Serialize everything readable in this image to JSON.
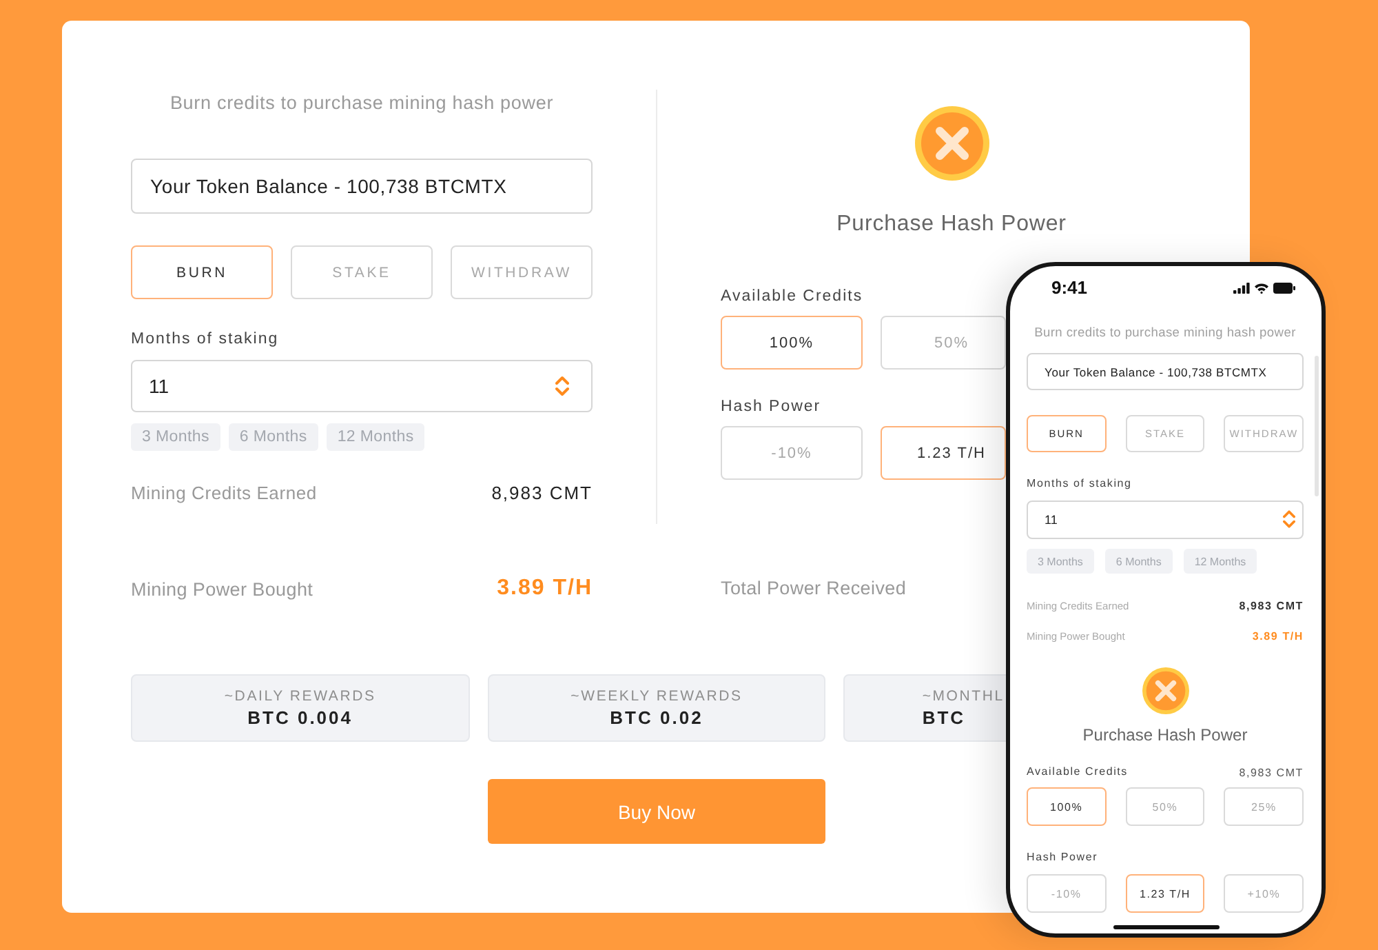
{
  "desktop": {
    "burn_panel": {
      "subtitle": "Burn credits to purchase mining hash power",
      "token_balance": {
        "value": "Your Token Balance - 100,738 BTCMTX"
      },
      "actions": [
        {
          "label": "BURN",
          "selected": true
        },
        {
          "label": "STAKE",
          "selected": false
        },
        {
          "label": "WITHDRAW",
          "selected": false
        }
      ],
      "months_label": "Months of staking",
      "months_input": {
        "value": "11"
      },
      "month_presets": [
        "3 Months",
        "6 Months",
        "12 Months"
      ],
      "credits_earned": {
        "label": "Mining Credits Earned",
        "value": "8,983 CMT"
      }
    },
    "purchase_panel": {
      "title": "Purchase Hash Power",
      "available_credits": {
        "label": "Available Credits",
        "options": [
          {
            "label": "100%",
            "selected": true
          },
          {
            "label": "50%",
            "selected": false
          }
        ]
      },
      "hash_power": {
        "label": "Hash Power",
        "options": [
          {
            "label": "-10%",
            "selected": false
          },
          {
            "label": "1.23 T/H",
            "selected": true
          }
        ]
      }
    },
    "power_bought": {
      "label": "Mining Power Bought",
      "value": "3.89 T/H"
    },
    "total_power": {
      "label": "Total Power Received"
    },
    "rewards": [
      {
        "label": "~DAILY REWARDS",
        "value": "BTC 0.004"
      },
      {
        "label": "~WEEKLY REWARDS",
        "value": "BTC 0.02"
      },
      {
        "label": "~MONTHL",
        "value": "BTC"
      }
    ],
    "buy_button": "Buy Now"
  },
  "phone": {
    "status_time": "9:41",
    "subtitle": "Burn credits to purchase mining hash power",
    "token_balance": {
      "value": "Your Token Balance - 100,738 BTCMTX"
    },
    "actions": [
      {
        "label": "BURN",
        "selected": true
      },
      {
        "label": "STAKE",
        "selected": false
      },
      {
        "label": "WITHDRAW",
        "selected": false
      }
    ],
    "months_label": "Months of staking",
    "months_input": {
      "value": "11"
    },
    "month_presets": [
      "3 Months",
      "6 Months",
      "12 Months"
    ],
    "stats": [
      {
        "label": "Mining Credits Earned",
        "value": "8,983 CMT",
        "highlighted": false
      },
      {
        "label": "Mining Power Bought",
        "value": "3.89 T/H",
        "highlighted": true
      }
    ],
    "title": "Purchase Hash Power",
    "available_credits": {
      "label": "Available Credits",
      "balance": "8,983 CMT",
      "options": [
        {
          "label": "100%",
          "selected": true
        },
        {
          "label": "50%",
          "selected": false
        },
        {
          "label": "25%",
          "selected": false
        }
      ]
    },
    "hash_power": {
      "label": "Hash Power",
      "options": [
        {
          "label": "-10%",
          "selected": false
        },
        {
          "label": "1.23 T/H",
          "selected": true
        },
        {
          "label": "+10%",
          "selected": false
        }
      ]
    }
  }
}
